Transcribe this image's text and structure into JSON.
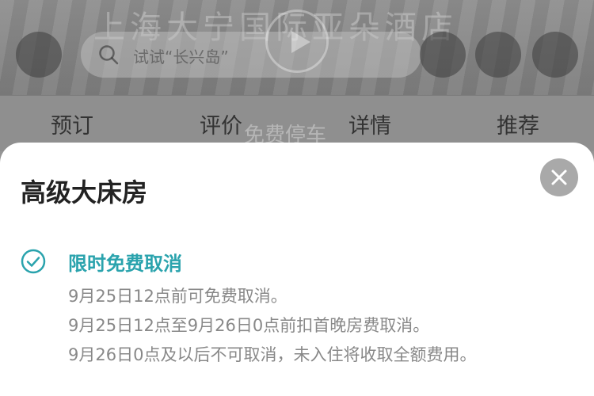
{
  "background": {
    "hotel_sign": "上海大宁国际亚朵酒店",
    "search": {
      "placeholder": "试试“长兴岛”"
    },
    "tabs": [
      {
        "label": "预订"
      },
      {
        "label": "评价"
      },
      {
        "label": "详情"
      },
      {
        "label": "推荐"
      }
    ],
    "promo_text": "免费停车"
  },
  "sheet": {
    "title": "高级大床房",
    "close_icon": "close-icon",
    "policy": {
      "icon": "check-circle-icon",
      "title": "限时免费取消",
      "lines": [
        "9月25日12点前可免费取消。",
        "9月25日12点至9月26日0点前扣首晚房费取消。",
        "9月26日0点及以后不可取消，未入住将收取全额费用。"
      ]
    }
  },
  "colors": {
    "accent": "#2aa3ad",
    "overlay": "#8f8f8f",
    "close_button": "#a9a9a9",
    "muted_text": "#888888"
  }
}
